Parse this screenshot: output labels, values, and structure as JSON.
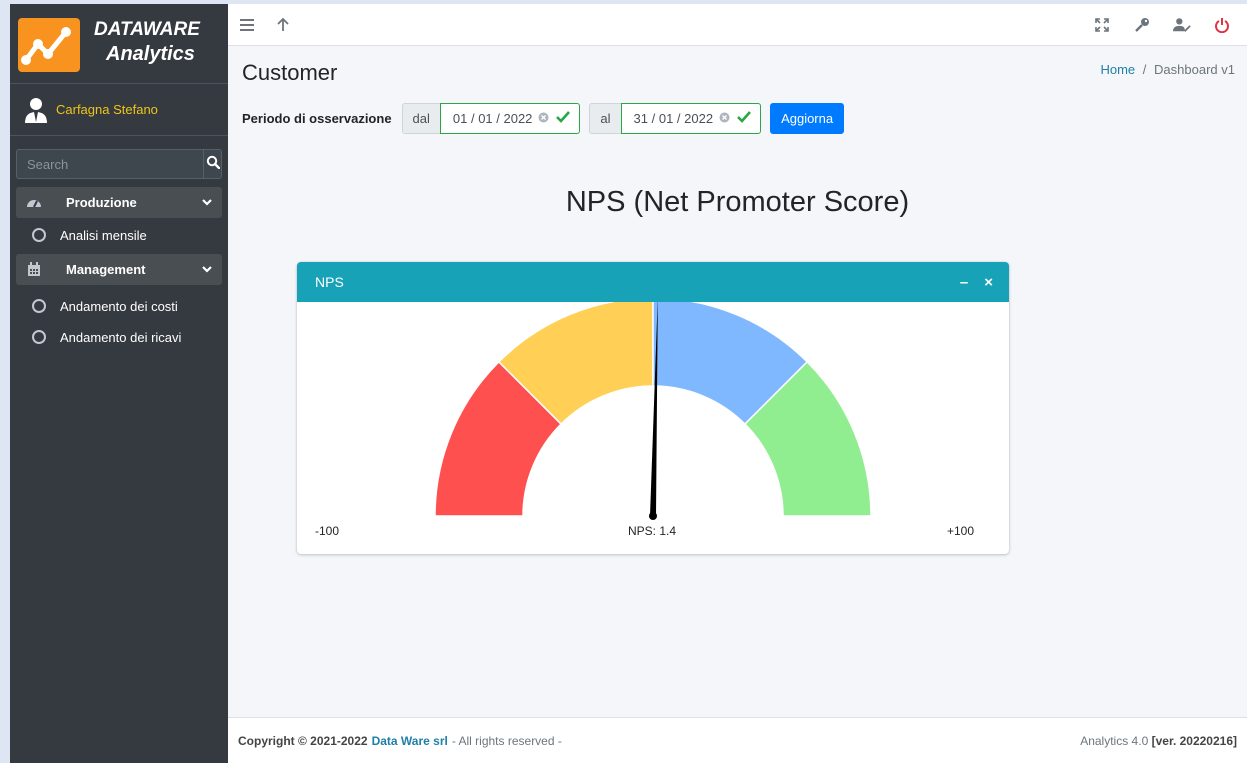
{
  "brand": {
    "line1": "DATAWARE",
    "line2": "Analytics"
  },
  "user": {
    "name": "Carfagna Stefano"
  },
  "sidebar": {
    "search_placeholder": "Search",
    "groups": [
      {
        "label": "Produzione",
        "items": [
          "Analisi mensile"
        ]
      },
      {
        "label": "Management",
        "items": [
          "Andamento dei costi",
          "Andamento dei ricavi"
        ]
      }
    ]
  },
  "page": {
    "title": "Customer",
    "breadcrumb": {
      "home": "Home",
      "separator": "/",
      "current": "Dashboard v1"
    }
  },
  "filter": {
    "label": "Periodo di osservazione",
    "from_addon": "dal",
    "from_value": "01 / 01 / 2022",
    "to_addon": "al",
    "to_value": "31 / 01 / 2022",
    "button": "Aggiorna"
  },
  "heading": "NPS (Net Promoter Score)",
  "card": {
    "title": "NPS",
    "tools": {
      "collapse": "–",
      "close": "×"
    }
  },
  "chart_data": {
    "type": "gauge",
    "min": -100,
    "max": 100,
    "min_label": "-100",
    "max_label": "+100",
    "value": 1.4,
    "value_label": "NPS: 1.4",
    "bands": [
      {
        "from": -100,
        "to": -50,
        "color": "#ff5050"
      },
      {
        "from": -50,
        "to": 0,
        "color": "#ffcf56"
      },
      {
        "from": 0,
        "to": 50,
        "color": "#80b8ff"
      },
      {
        "from": 50,
        "to": 100,
        "color": "#90ee90"
      }
    ]
  },
  "footer": {
    "copyright": "Copyright © 2021-2022",
    "company": "Data Ware srl",
    "rights": "- All rights reserved -",
    "version_prefix": "Analytics 4.0",
    "version": "[ver. 20220216]"
  },
  "icons": {
    "menu": "bars-icon",
    "up": "arrow-up-icon",
    "fullscreen": "expand-icon",
    "key": "key-icon",
    "user_edit": "user-edit-icon",
    "power": "power-icon"
  },
  "colors": {
    "accent": "#17a2b8",
    "primary": "#007bff",
    "sidebar": "#343a40",
    "power": "#dc3545",
    "success": "#28a745"
  }
}
